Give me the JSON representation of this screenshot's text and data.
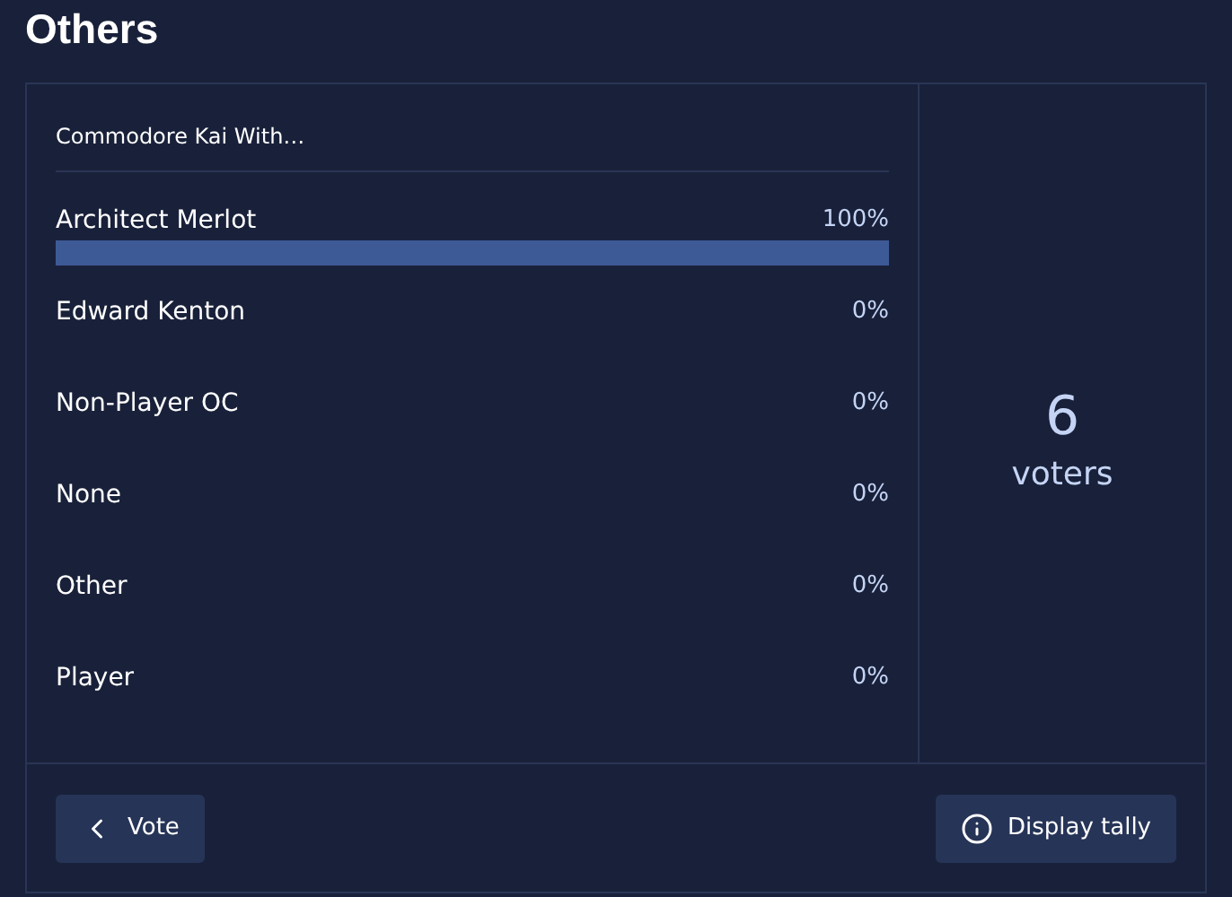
{
  "heading": "Others",
  "poll": {
    "question": "Commodore Kai With…",
    "options": [
      {
        "label": "Architect Merlot",
        "percent": "100%"
      },
      {
        "label": "Edward Kenton",
        "percent": "0%"
      },
      {
        "label": "Non-Player OC",
        "percent": "0%"
      },
      {
        "label": "None",
        "percent": "0%"
      },
      {
        "label": "Other",
        "percent": "0%"
      },
      {
        "label": "Player",
        "percent": "0%"
      }
    ],
    "voter_count": "6",
    "voter_label": "voters"
  },
  "buttons": [
    {
      "kind": "back",
      "label": "Vote"
    },
    {
      "kind": "info",
      "label": "Display tally"
    }
  ]
}
